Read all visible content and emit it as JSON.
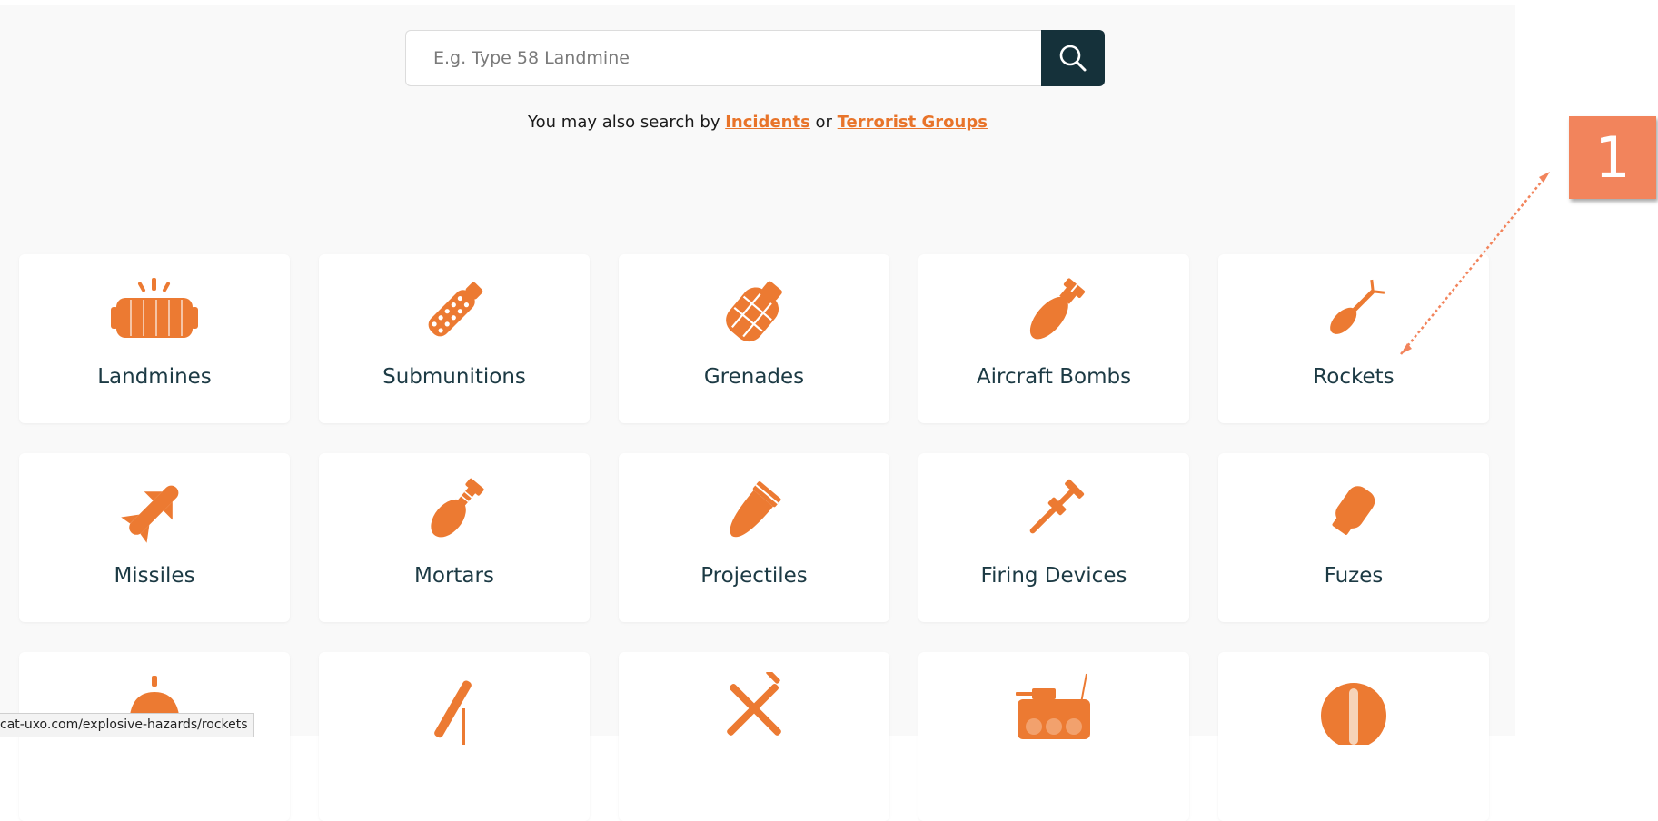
{
  "search": {
    "placeholder": "E.g. Type 58 Landmine",
    "button_icon": "search-icon"
  },
  "also_search": {
    "prefix": "You may also search by",
    "incidents_link": "Incidents",
    "joiner": "or",
    "terrorist_groups_link": "Terrorist Groups"
  },
  "categories": [
    {
      "label": "Landmines",
      "icon": "landmine-icon"
    },
    {
      "label": "Submunitions",
      "icon": "submunition-icon"
    },
    {
      "label": "Grenades",
      "icon": "grenade-icon"
    },
    {
      "label": "Aircraft Bombs",
      "icon": "aircraft-bomb-icon"
    },
    {
      "label": "Rockets",
      "icon": "rocket-icon"
    },
    {
      "label": "Missiles",
      "icon": "missile-icon"
    },
    {
      "label": "Mortars",
      "icon": "mortar-icon"
    },
    {
      "label": "Projectiles",
      "icon": "projectile-icon"
    },
    {
      "label": "Firing Devices",
      "icon": "firing-device-icon"
    },
    {
      "label": "Fuzes",
      "icon": "fuze-icon"
    },
    {
      "label": "",
      "icon": "sea-mine-icon"
    },
    {
      "label": "",
      "icon": "launcher-icon"
    },
    {
      "label": "",
      "icon": "improvised-device-icon"
    },
    {
      "label": "",
      "icon": "vehicle-icon"
    },
    {
      "label": "",
      "icon": "stop-sign-icon"
    }
  ],
  "status_bar": {
    "url": "cat-uxo.com/explosive-hazards/rockets"
  },
  "annotation": {
    "number": "1"
  },
  "colors": {
    "accent": "#e8742a",
    "search_button": "#15313a",
    "callout": "#f2845c",
    "label_text": "#1c3a44"
  }
}
